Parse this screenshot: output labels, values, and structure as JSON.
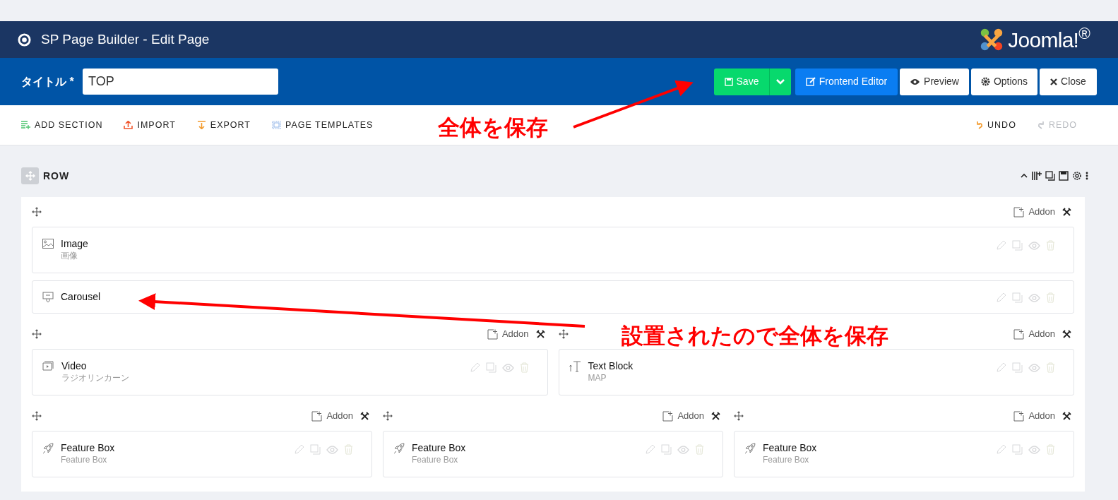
{
  "window": {
    "title": "SP Page Builder - Edit Page",
    "brand": "Joomla!$^{®}$"
  },
  "title_field": {
    "label": "タイトル *",
    "value": "TOP"
  },
  "actions": [
    {
      "kind": "save",
      "label": "Save"
    },
    {
      "kind": "dropdown"
    },
    {
      "kind": "frontend",
      "label": "Frontend Editor"
    },
    {
      "kind": "preview",
      "label": "Preview"
    },
    {
      "kind": "options",
      "label": "Options"
    },
    {
      "kind": "close",
      "label": "Close"
    }
  ],
  "toolbar": {
    "left": [
      {
        "kind": "add",
        "label": "ADD SECTION"
      },
      {
        "kind": "import",
        "label": "IMPORT"
      },
      {
        "kind": "export",
        "label": "EXPORT"
      },
      {
        "kind": "templates",
        "label": "PAGE TEMPLATES"
      }
    ],
    "right": [
      {
        "kind": "undo",
        "label": "UNDO",
        "disabled": false
      },
      {
        "kind": "redo",
        "label": "REDO",
        "disabled": true
      }
    ]
  },
  "section": {
    "label": "ROW",
    "rows": [
      {
        "columns": [
          {
            "add_label": "Addon",
            "addons": [
              {
                "kind": "image",
                "title": "Image",
                "subtitle": "画像"
              },
              {
                "kind": "carousel",
                "title": "Carousel"
              }
            ]
          }
        ]
      },
      {
        "columns": [
          {
            "add_label": "Addon",
            "addons": [
              {
                "kind": "video",
                "title": "Video",
                "subtitle": "ラジオリンカーン"
              }
            ]
          },
          {
            "add_label": "Addon",
            "addons": [
              {
                "kind": "text",
                "title": "Text Block",
                "subtitle": "MAP"
              }
            ]
          }
        ]
      },
      {
        "columns": [
          {
            "add_label": "Addon",
            "addons": [
              {
                "kind": "feature",
                "title": "Feature Box",
                "subtitle": "Feature Box"
              }
            ]
          },
          {
            "add_label": "Addon",
            "addons": [
              {
                "kind": "feature",
                "title": "Feature Box",
                "subtitle": "Feature Box"
              }
            ]
          },
          {
            "add_label": "Addon",
            "addons": [
              {
                "kind": "feature",
                "title": "Feature Box",
                "subtitle": "Feature Box"
              }
            ]
          }
        ]
      }
    ]
  },
  "annotations": [
    {
      "text": "全体を保存"
    },
    {
      "text": "設置されたので全体を保存"
    }
  ]
}
